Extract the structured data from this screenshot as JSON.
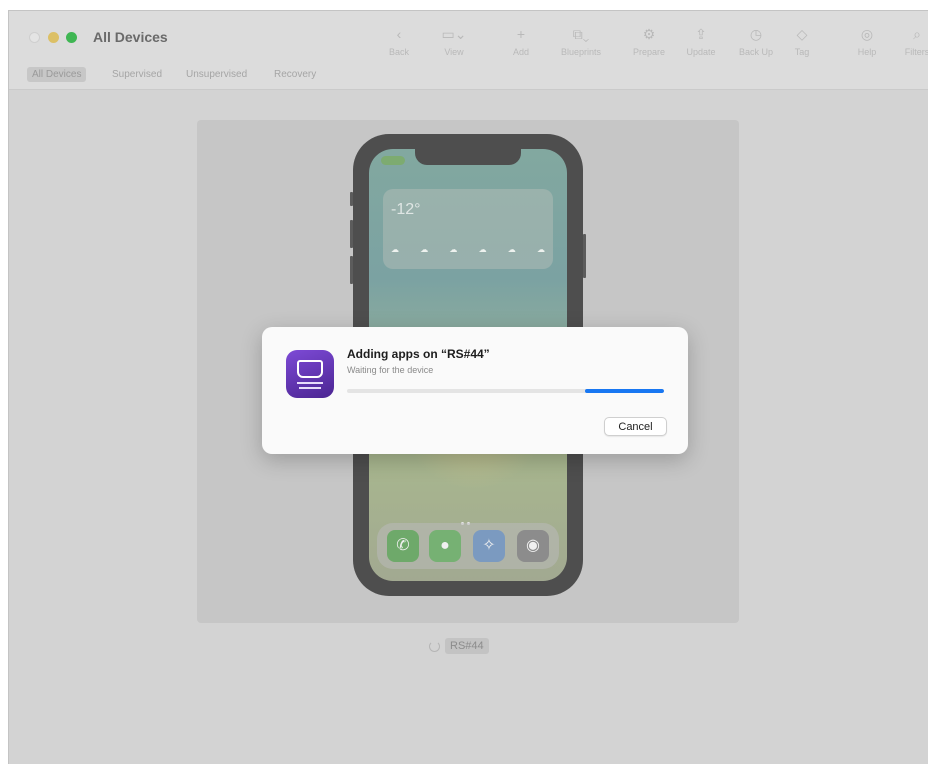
{
  "window": {
    "title": "All Devices"
  },
  "toolbar": [
    {
      "name": "back",
      "label": "Back",
      "icon": "chevron-left-icon",
      "glyph": "‹"
    },
    {
      "name": "view",
      "label": "View",
      "icon": "view-icon",
      "glyph": "▭⌄"
    },
    {
      "name": "add",
      "label": "Add",
      "icon": "plus-icon",
      "glyph": "+"
    },
    {
      "name": "blueprints",
      "label": "Blueprints",
      "icon": "blueprints-icon",
      "glyph": "⧉⌄"
    },
    {
      "name": "prepare",
      "label": "Prepare",
      "icon": "prepare-icon",
      "glyph": "⚙"
    },
    {
      "name": "update",
      "label": "Update",
      "icon": "update-icon",
      "glyph": "⇪"
    },
    {
      "name": "back-up",
      "label": "Back Up",
      "icon": "clock-icon",
      "glyph": "◷"
    },
    {
      "name": "tag",
      "label": "Tag",
      "icon": "tag-icon",
      "glyph": "◇"
    },
    {
      "name": "help",
      "label": "Help",
      "icon": "help-icon",
      "glyph": "◎"
    },
    {
      "name": "filters",
      "label": "Filters",
      "icon": "search-icon",
      "glyph": "⌕"
    }
  ],
  "tabs": [
    {
      "label": "All Devices",
      "active": true
    },
    {
      "label": "Supervised",
      "active": false
    },
    {
      "label": "Unsupervised",
      "active": false
    },
    {
      "label": "Recovery",
      "active": false
    }
  ],
  "phone": {
    "weather_temp": "-12°"
  },
  "device": {
    "name": "RS#44"
  },
  "dialog": {
    "title": "Adding apps on “RS#44”",
    "subtitle": "Waiting for the device",
    "progress_start": 0.75,
    "progress_end": 1.0,
    "cancel_label": "Cancel",
    "accent_color": "#1877f2"
  }
}
